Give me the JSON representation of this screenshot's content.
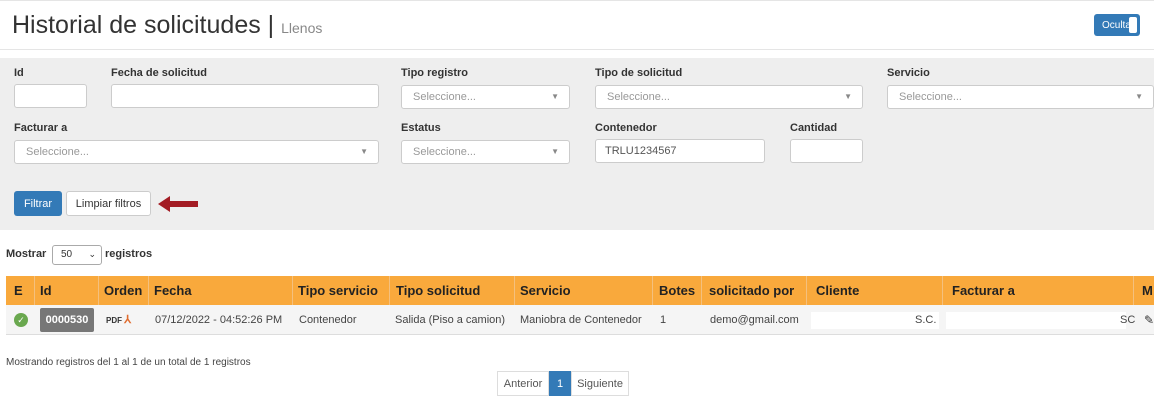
{
  "header": {
    "title": "Historial de solicitudes",
    "separator": "|",
    "subtitle": "Llenos",
    "toggle_label": "Ocultar"
  },
  "filters": {
    "id": {
      "label": "Id",
      "value": ""
    },
    "fecha": {
      "label": "Fecha de solicitud",
      "value": ""
    },
    "tipo_registro": {
      "label": "Tipo registro",
      "placeholder": "Seleccione..."
    },
    "tipo_solicitud": {
      "label": "Tipo de solicitud",
      "placeholder": "Seleccione..."
    },
    "servicio": {
      "label": "Servicio",
      "placeholder": "Seleccione..."
    },
    "facturar_a": {
      "label": "Facturar a",
      "placeholder": "Seleccione..."
    },
    "estatus": {
      "label": "Estatus",
      "placeholder": "Seleccione..."
    },
    "contenedor": {
      "label": "Contenedor",
      "value": "TRLU1234567"
    },
    "cantidad": {
      "label": "Cantidad",
      "value": ""
    },
    "filter_button": "Filtrar",
    "clear_button": "Limpiar filtros"
  },
  "length": {
    "prefix": "Mostrar",
    "value": "50",
    "suffix": "registros"
  },
  "table": {
    "headers": [
      "E",
      "Id",
      "Orden",
      "Fecha",
      "Tipo servicio",
      "Tipo solicitud",
      "Servicio",
      "Botes",
      "solicitado por",
      "Cliente",
      "Facturar a",
      "M"
    ],
    "rows": [
      {
        "status": "approved",
        "id": "0000530",
        "orden": "PDF",
        "fecha": "07/12/2022 - 04:52:26 PM",
        "tipo_servicio": "Contenedor",
        "tipo_solicitud": "Salida (Piso a camion)",
        "servicio": "Maniobra de Contenedor",
        "botes": "1",
        "solicitado_por": "demo@gmail.com",
        "cliente": "S.C.",
        "facturar_a": "SC"
      }
    ]
  },
  "info": "Mostrando registros del 1 al 1 de un total de 1 registros",
  "pagination": {
    "prev": "Anterior",
    "current": "1",
    "next": "Siguiente"
  },
  "colors": {
    "accent": "#337ab7",
    "table_header": "#f9a93c",
    "arrow": "#a31c24",
    "badge": "#777777",
    "check": "#6aa84f"
  }
}
